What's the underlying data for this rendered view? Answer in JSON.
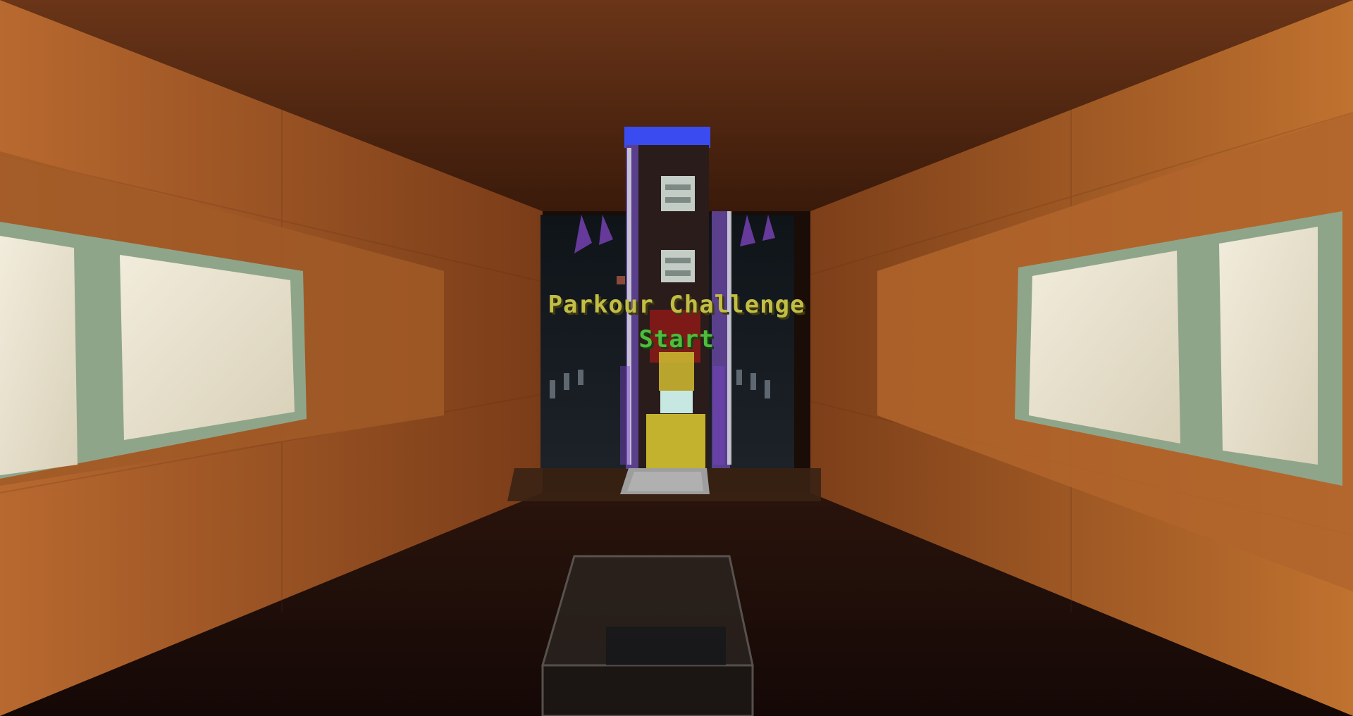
{
  "hologram": {
    "title": "Parkour Challenge",
    "subtitle": "Start"
  },
  "colors": {
    "wall_orange": "#b4642e",
    "floor_dark": "#1a0b08",
    "hologram_title": "#c2bd45",
    "hologram_subtitle": "#4fbd3c",
    "portal_blue": "#3a4cf0",
    "window_pane": "#ece4cf"
  },
  "icons": {
    "checkpoint_plate": "pressure-plate-icon",
    "pearl": "ender-pearl-icon"
  }
}
